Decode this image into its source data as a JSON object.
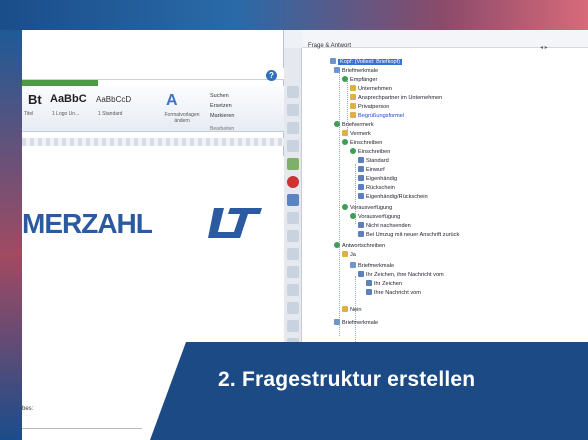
{
  "word": {
    "styles": [
      {
        "preview": "Bt",
        "label": "Titel"
      },
      {
        "preview": "AaBbC",
        "label": "1 Logo Un..."
      },
      {
        "preview": "AaBbCcD",
        "label": "1 Standard"
      }
    ],
    "format_template_label": "Formatvorlagen ändern",
    "edit_items": [
      "Suchen",
      "Ersetzen",
      "Markieren"
    ],
    "edit_group": "Bearbeiten",
    "logo_text": "MERZAHL",
    "doc_text": "bes:"
  },
  "tree": {
    "panel_title": "Frage & Antwort",
    "nodes": [
      {
        "label": "Kopf: (Vollext: Briefkopf)",
        "icon": "doc",
        "selected": true
      },
      {
        "label": "Briefmerkmale",
        "icon": "doc"
      },
      {
        "label": "Empfänger",
        "icon": "q"
      },
      {
        "label": "Unternehmen",
        "icon": "fld"
      },
      {
        "label": "Ansprechpartner im Unternehmen",
        "icon": "fld"
      },
      {
        "label": "Privatperson",
        "icon": "fld"
      },
      {
        "label": "Begrüßungsformel",
        "icon": "fld",
        "blue": true
      },
      {
        "label": "Briefvermerk",
        "icon": "q"
      },
      {
        "label": "Vermerk",
        "icon": "fld"
      },
      {
        "label": "Einschreiben",
        "icon": "q"
      },
      {
        "label": "Einschreiben",
        "icon": "q"
      },
      {
        "label": "Standard",
        "icon": "ans"
      },
      {
        "label": "Einwurf",
        "icon": "ans"
      },
      {
        "label": "Eigenhändig",
        "icon": "ans"
      },
      {
        "label": "Rückschein",
        "icon": "ans"
      },
      {
        "label": "Eigenhändig/Rückschein",
        "icon": "ans"
      },
      {
        "label": "Vorausverfügung",
        "icon": "q"
      },
      {
        "label": "Vorausverfügung",
        "icon": "q"
      },
      {
        "label": "Nicht nachsenden",
        "icon": "ans"
      },
      {
        "label": "Bei Umzug mit neuer Anschrift zurück",
        "icon": "ans"
      },
      {
        "label": "Antwortschreiben",
        "icon": "q"
      },
      {
        "label": "Ja",
        "icon": "fld"
      },
      {
        "label": "Briefmerkmale",
        "icon": "doc"
      },
      {
        "label": "Ihr Zeichen, ihre Nachricht vom",
        "icon": "ans"
      },
      {
        "label": "Ihr Zeichen",
        "icon": "ans"
      },
      {
        "label": "Ihre Nachricht vom",
        "icon": "ans"
      },
      {
        "label": "Nein",
        "icon": "fld"
      },
      {
        "label": "Briefmerkmale",
        "icon": "doc"
      }
    ]
  },
  "banner": {
    "text": "2. Fragestruktur erstellen",
    "color": "#1b4a85"
  }
}
